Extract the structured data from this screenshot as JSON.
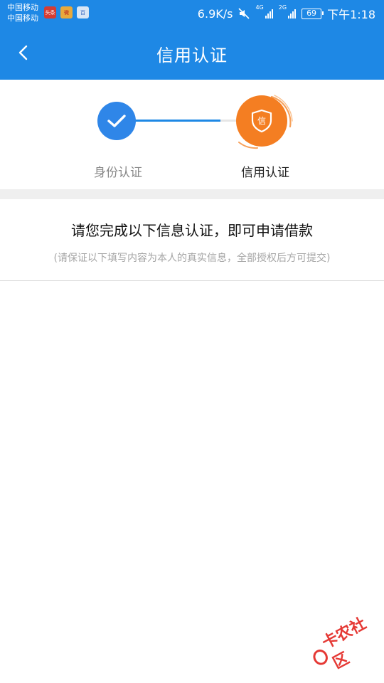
{
  "status_bar": {
    "carrier_1": "中国移动",
    "carrier_2": "中国移动",
    "app_toutiao_label": "头条",
    "app_weibo_label": "微",
    "app_baidu_label": "百",
    "network_speed": "6.9K/s",
    "net_4g": "4G",
    "net_2g": "2G",
    "battery": "69",
    "time": "下午1:18",
    "bar_color": "#1e88e5"
  },
  "nav": {
    "title": "信用认证",
    "back_icon": "chevron-left-icon"
  },
  "steps": [
    {
      "label": "身份认证",
      "state": "done",
      "icon": "check-icon",
      "color": "#2f86e8"
    },
    {
      "label": "信用认证",
      "state": "current",
      "icon": "shield-icon",
      "badge": "信",
      "color": "#f47e22"
    }
  ],
  "info": {
    "title": "请您完成以下信息认证，即可申请借款",
    "subtitle": "(请保证以下填写内容为本人的真实信息，全部授权后方可提交)"
  },
  "watermark": {
    "text": "卡农社区",
    "color": "#e53935"
  }
}
